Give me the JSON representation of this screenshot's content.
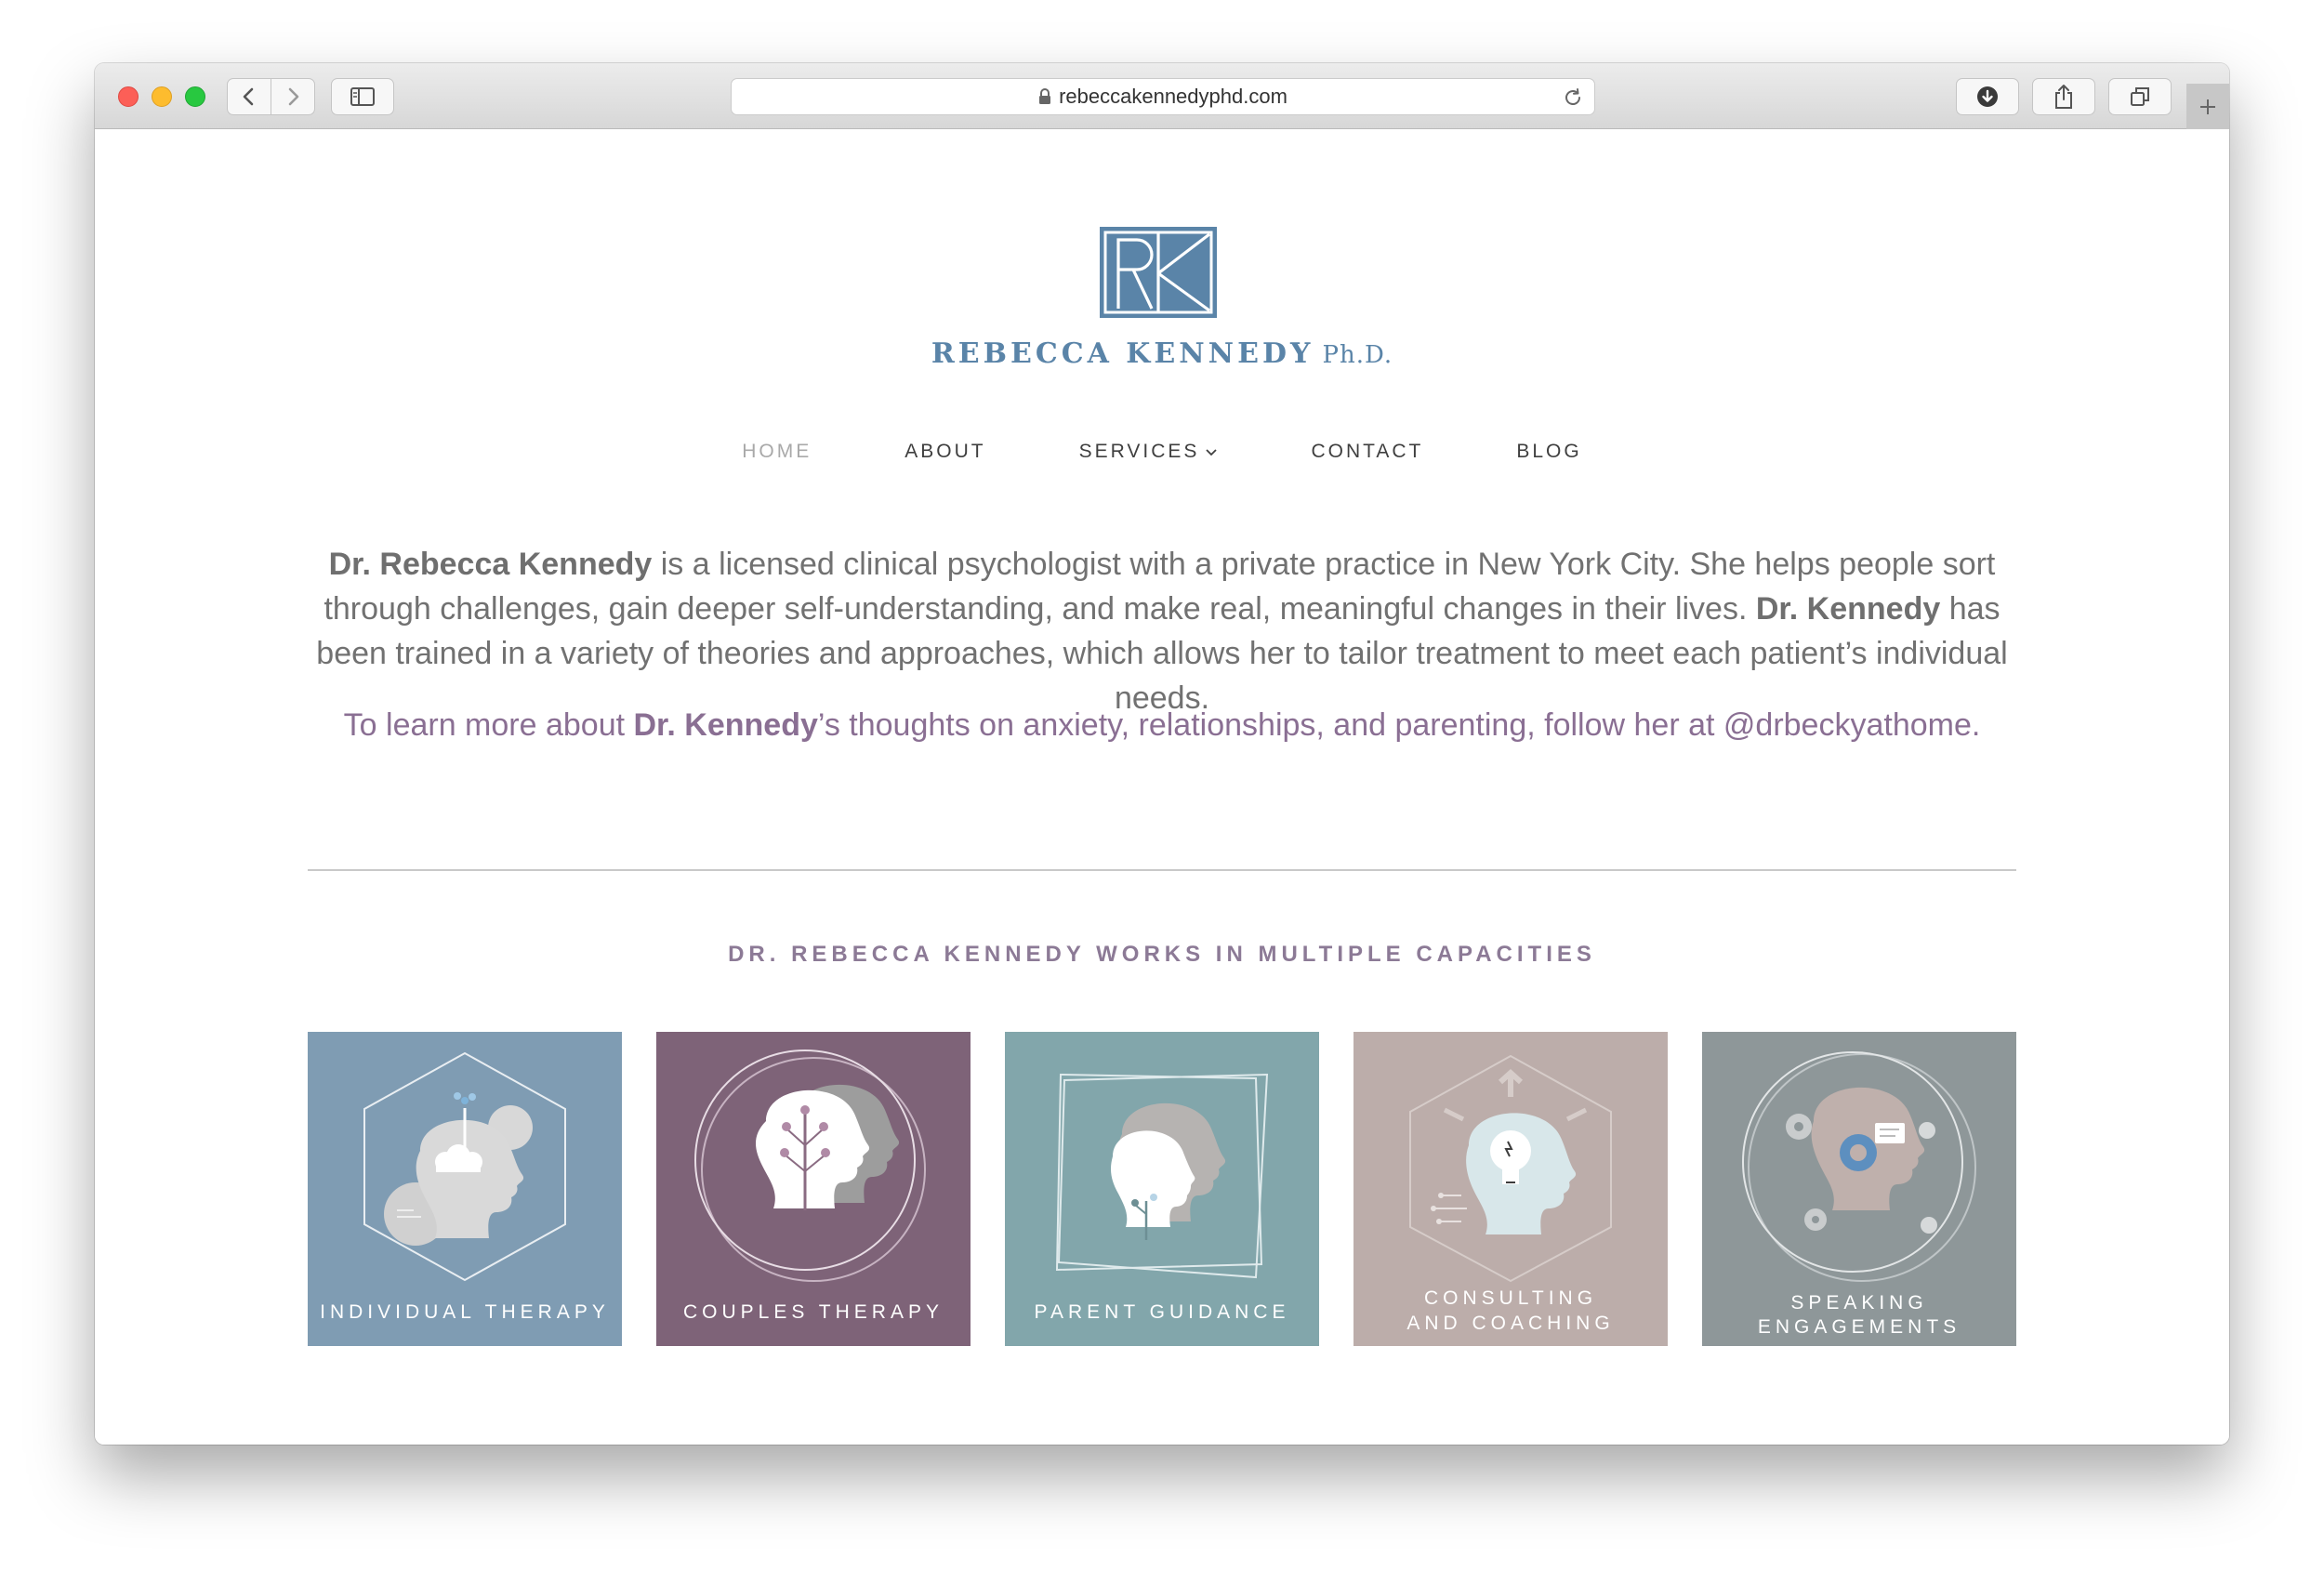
{
  "browser": {
    "url": "rebeccakennedyphd.com"
  },
  "site": {
    "brand_name": "REBECCA KENNEDY",
    "brand_credential": "Ph.D."
  },
  "nav": {
    "items": [
      {
        "label": "HOME",
        "active": true
      },
      {
        "label": "ABOUT"
      },
      {
        "label": "SERVICES",
        "has_dropdown": true
      },
      {
        "label": "CONTACT"
      },
      {
        "label": "BLOG"
      }
    ]
  },
  "intro": {
    "name_bold": "Dr. Rebecca Kennedy",
    "text_1": " is a licensed clinical psychologist with a private practice in New York City. She helps people sort through challenges, gain deeper self-understanding, and make real, meaningful changes in their lives. ",
    "name_bold_2": "Dr. Kennedy",
    "text_2": " has been trained in a variety of theories and approaches, which allows her to tailor treatment to meet each patient’s individual needs."
  },
  "follow": {
    "text_1": "To learn more about ",
    "name_bold": "Dr. Kennedy",
    "text_2": "’s thoughts on anxiety, relationships, and parenting, follow her at @drbeckyathome."
  },
  "capacities": {
    "title": "DR. REBECCA KENNEDY WORKS IN MULTIPLE CAPACITIES",
    "tiles": [
      {
        "label_1": "INDIVIDUAL THERAPY",
        "label_2": "",
        "bg": "#7f9cb3",
        "icon": "head-cloud-icon"
      },
      {
        "label_1": "COUPLES THERAPY",
        "label_2": "",
        "bg": "#7e6378",
        "icon": "two-heads-tree-icon"
      },
      {
        "label_1": "PARENT GUIDANCE",
        "label_2": "",
        "bg": "#82a6ab",
        "icon": "parent-child-heads-icon"
      },
      {
        "label_1": "CONSULTING",
        "label_2": "AND COACHING",
        "bg": "#bcadaa",
        "icon": "head-lightbulb-icon"
      },
      {
        "label_1": "SPEAKING",
        "label_2": "ENGAGEMENTS",
        "bg": "#8e9799",
        "icon": "head-gears-icon"
      }
    ]
  },
  "colors": {
    "brand_blue": "#5a84a8",
    "accent_purple": "#8a6f93"
  }
}
